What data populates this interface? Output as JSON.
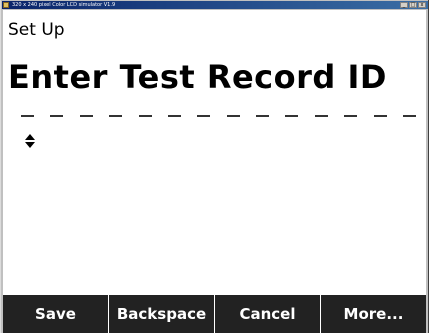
{
  "window": {
    "title": "320 x 240 pixel Color LCD simulator V1.9",
    "controls": [
      "_",
      "□",
      "x"
    ]
  },
  "screen": {
    "title": "Set Up",
    "prompt": "Enter Test Record ID",
    "entry_slots": 14,
    "entry_value": ""
  },
  "softkeys": [
    {
      "label": "Save"
    },
    {
      "label": "Backspace"
    },
    {
      "label": "Cancel"
    },
    {
      "label": "More..."
    }
  ],
  "colors": {
    "softkey_bg": "#222222",
    "softkey_text": "#ffffff",
    "screen_bg": "#ffffff",
    "titlebar_start": "#0a246a",
    "titlebar_end": "#3a6ea5"
  },
  "icons": {
    "app": "lcd-app-icon",
    "scroll": "up-down-arrows-icon"
  }
}
